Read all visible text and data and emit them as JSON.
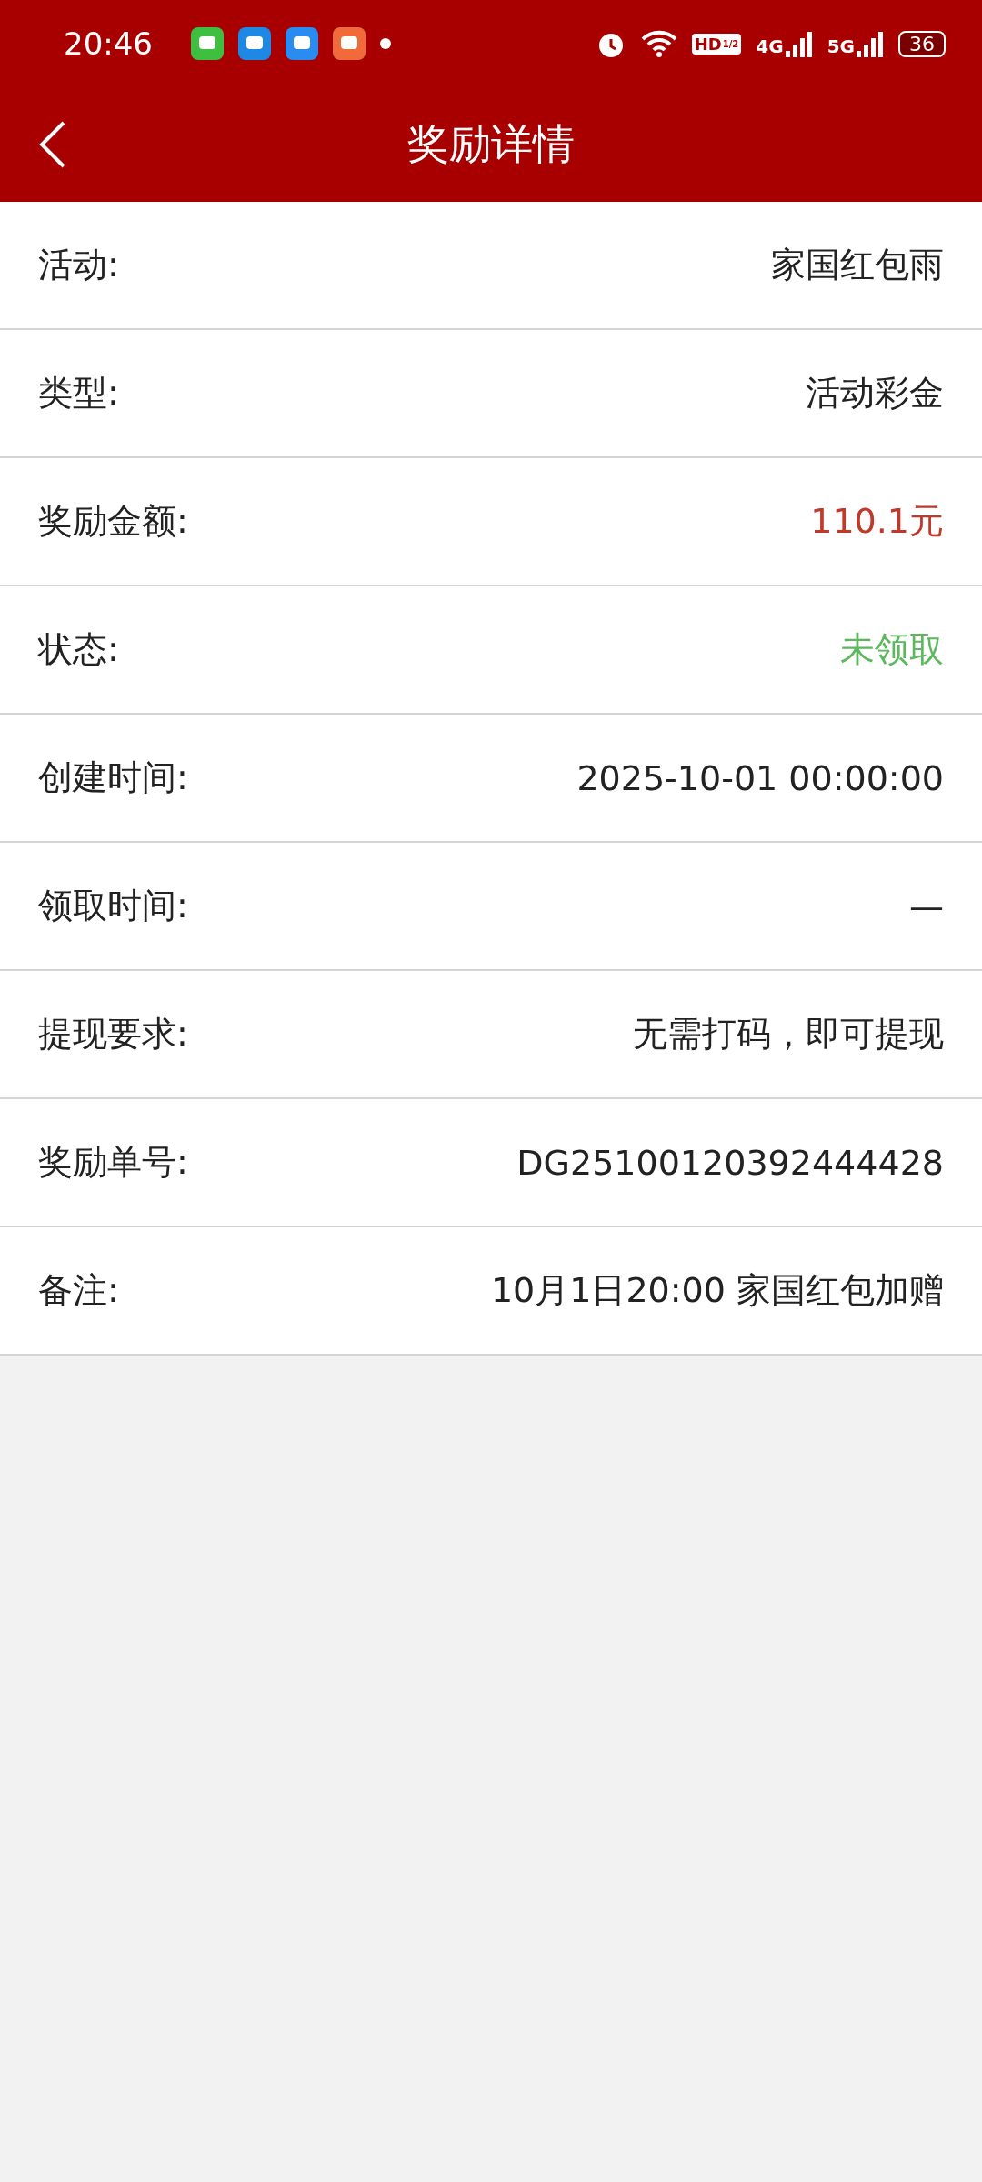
{
  "status_bar": {
    "time": "20:46",
    "hd_label": "HD",
    "hd_sub": "1/2",
    "networks": [
      "4G",
      "5G"
    ],
    "battery": "36"
  },
  "header": {
    "title": "奖励详情"
  },
  "rows": [
    {
      "label": "活动:",
      "value": "家国红包雨"
    },
    {
      "label": "类型:",
      "value": "活动彩金"
    },
    {
      "label": "奖励金额:",
      "value": "110.1元",
      "color": "#c0392b"
    },
    {
      "label": "状态:",
      "value": "未领取",
      "color": "#5cb85c"
    },
    {
      "label": "创建时间:",
      "value": "2025-10-01 00:00:00"
    },
    {
      "label": "领取时间:",
      "value": "—"
    },
    {
      "label": "提现要求:",
      "value": "无需打码，即可提现"
    },
    {
      "label": "奖励单号:",
      "value": "DG25100120392444428"
    },
    {
      "label": "备注:",
      "value": "10月1日20:00 家国红包加赠"
    }
  ]
}
